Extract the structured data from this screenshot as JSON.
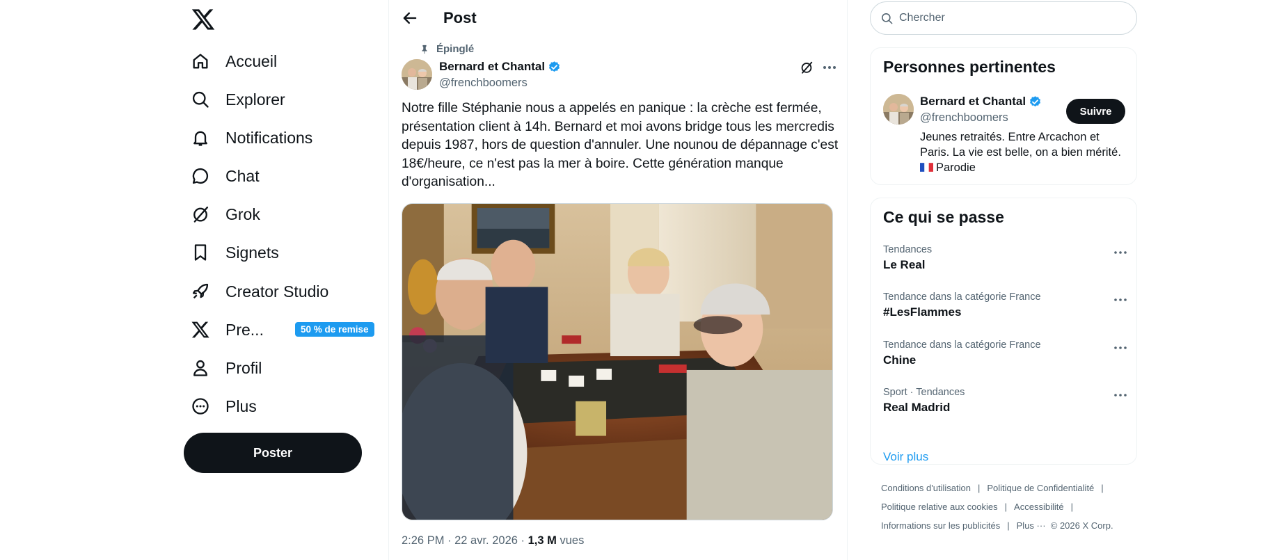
{
  "nav": {
    "items": [
      {
        "label": "Accueil",
        "icon": "home-icon"
      },
      {
        "label": "Explorer",
        "icon": "search-icon"
      },
      {
        "label": "Notifications",
        "icon": "bell-icon"
      },
      {
        "label": "Chat",
        "icon": "chat-bubble-icon"
      },
      {
        "label": "Grok",
        "icon": "grok-icon"
      },
      {
        "label": "Signets",
        "icon": "bookmark-icon"
      },
      {
        "label": "Creator Studio",
        "icon": "rocket-icon"
      },
      {
        "label": "Pre...",
        "icon": "x-logo-icon",
        "badge": "50 % de remise"
      },
      {
        "label": "Profil",
        "icon": "person-icon"
      },
      {
        "label": "Plus",
        "icon": "more-circle-icon"
      }
    ],
    "post_button": "Poster"
  },
  "header": {
    "title": "Post"
  },
  "tweet": {
    "pinned_label": "Épinglé",
    "author_name": "Bernard et Chantal",
    "author_handle": "@frenchboomers",
    "text": "Notre fille Stéphanie nous a appelés en panique : la crèche est fermée, présentation client à 14h. Bernard et moi avons bridge tous les mercredis depuis 1987, hors de question d'annuler. Une nounou de dépannage c'est 18€/heure, ce n'est pas la mer à boire. Cette génération manque d'organisation...",
    "time": "2:26 PM · 22 avr. 2026 · ",
    "views_count": "1,3 M",
    "views_label": " vues"
  },
  "search": {
    "placeholder": "Chercher"
  },
  "relevant": {
    "title": "Personnes pertinentes",
    "name": "Bernard et Chantal",
    "handle": "@frenchboomers",
    "follow_label": "Suivre",
    "bio_line1": "Jeunes retraités. Entre Arcachon et Paris. La vie est belle, on a bien mérité.",
    "bio_line2": "Parodie"
  },
  "trends": {
    "title": "Ce qui se passe",
    "items": [
      {
        "context": "Tendances",
        "name": "Le Real"
      },
      {
        "context": "Tendance dans la catégorie France",
        "name": "#LesFlammes"
      },
      {
        "context": "Tendance dans la catégorie France",
        "name": "Chine"
      },
      {
        "context": "Sport · Tendances",
        "name": "Real Madrid"
      }
    ],
    "see_more": "Voir plus"
  },
  "footer": {
    "links": [
      "Conditions d'utilisation",
      "Politique de Confidentialité",
      "Politique relative aux cookies",
      "Accessibilité",
      "Informations sur les publicités",
      "Plus ···"
    ],
    "copyright": "© 2026 X Corp."
  },
  "colors": {
    "accent": "#1d9bf0",
    "text": "#0f1419",
    "muted": "#536471",
    "border": "#eff3f4"
  }
}
